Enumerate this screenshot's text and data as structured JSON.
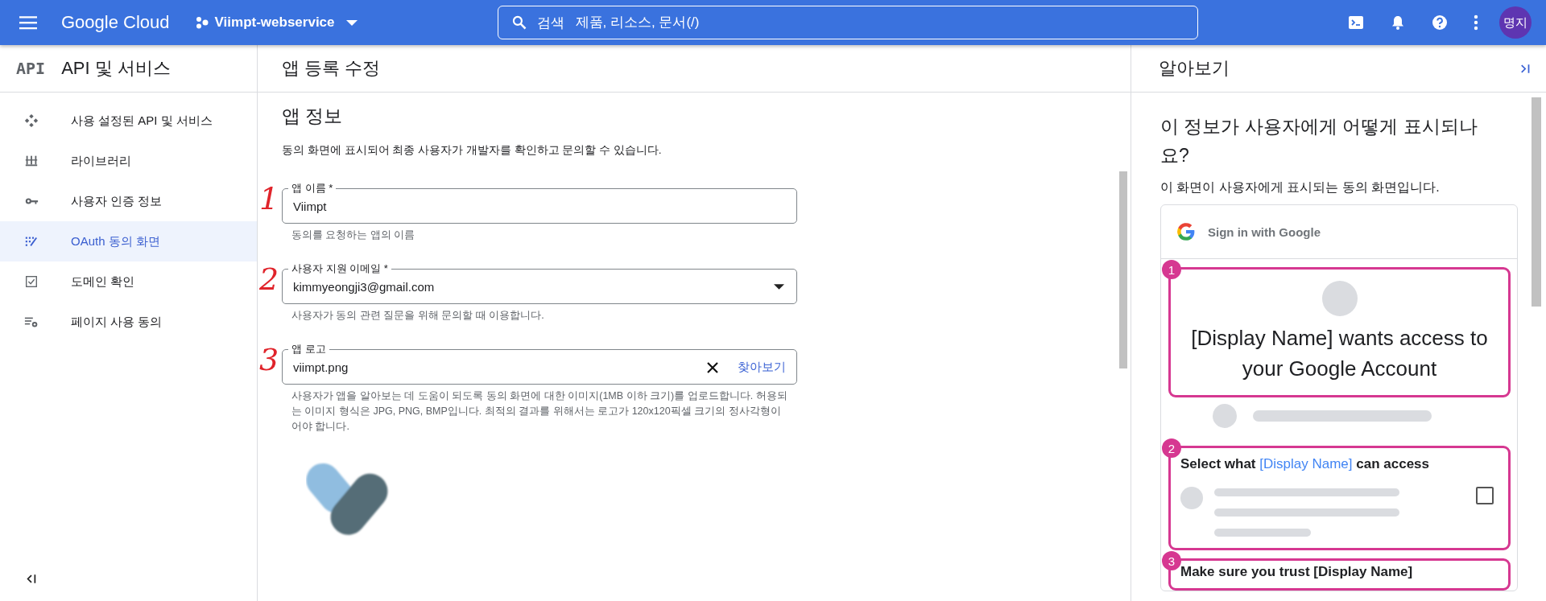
{
  "topbar": {
    "brand": "Google Cloud",
    "project": "Viimpt-webservice",
    "search_label": "검색",
    "search_placeholder": "제품, 리소스, 문서(/)",
    "avatar": "명지"
  },
  "sidebar": {
    "logo": "API",
    "title": "API 및 서비스",
    "items": [
      {
        "label": "사용 설정된 API 및 서비스",
        "selected": false
      },
      {
        "label": "라이브러리",
        "selected": false
      },
      {
        "label": "사용자 인증 정보",
        "selected": false
      },
      {
        "label": "OAuth 동의 화면",
        "selected": true
      },
      {
        "label": "도메인 확인",
        "selected": false
      },
      {
        "label": "페이지 사용 동의",
        "selected": false
      }
    ]
  },
  "page_title": "앱 등록 수정",
  "section": {
    "title": "앱 정보",
    "description": "동의 화면에 표시되어 최종 사용자가 개발자를 확인하고 문의할 수 있습니다.",
    "fields": [
      {
        "kind": "text",
        "label": "앱 이름 *",
        "value": "Viimpt",
        "hint": "동의를 요청하는 앱의 이름",
        "annotation": "1"
      },
      {
        "kind": "select",
        "label": "사용자 지원 이메일 *",
        "value": "kimmyeongji3@gmail.com",
        "hint": "사용자가 동의 관련 질문을 위해 문의할 때 이용합니다.",
        "annotation": "2"
      },
      {
        "kind": "file",
        "label": "앱 로고",
        "value": "viimpt.png",
        "action": "찾아보기",
        "hint": "사용자가 앱을 알아보는 데 도움이 되도록 동의 화면에 대한 이미지(1MB 이하 크기)를 업로드합니다. 허용되는 이미지 형식은 JPG, PNG, BMP입니다. 최적의 결과를 위해서는 로고가 120x120픽셀 크기의 정사각형이어야 합니다.",
        "annotation": "3"
      }
    ]
  },
  "panel": {
    "title": "알아보기",
    "heading": "이 정보가 사용자에게 어떻게 표시되나요?",
    "description": "이 화면이 사용자에게 표시되는 동의 화면입니다.",
    "preview": {
      "header": "Sign in with Google",
      "steps": [
        {
          "number": "1",
          "kind": "title",
          "text": "[Display Name] wants access to your Google Account"
        },
        {
          "number": "2",
          "kind": "scopes",
          "before": "Select what ",
          "highlight": "[Display Name]",
          "after": " can access",
          "checked": false
        },
        {
          "number": "3",
          "kind": "trust",
          "text": "Make sure you trust [Display Name]"
        }
      ]
    }
  }
}
